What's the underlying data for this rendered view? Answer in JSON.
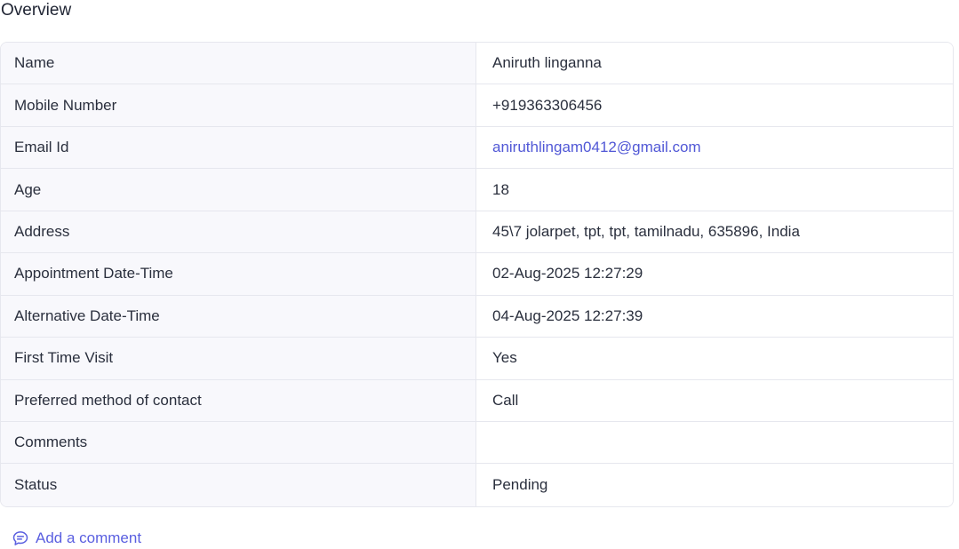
{
  "overview": {
    "title": "Overview",
    "rows": [
      {
        "label": "Name",
        "value": "Aniruth linganna"
      },
      {
        "label": "Mobile Number",
        "value": "+919363306456"
      },
      {
        "label": "Email Id",
        "value": "aniruthlingam0412@gmail.com"
      },
      {
        "label": "Age",
        "value": "18"
      },
      {
        "label": "Address",
        "value": "45\\7 jolarpet, tpt, tpt, tamilnadu, 635896, India"
      },
      {
        "label": "Appointment Date-Time",
        "value": "02-Aug-2025 12:27:29"
      },
      {
        "label": "Alternative Date-Time",
        "value": "04-Aug-2025 12:27:39"
      },
      {
        "label": "First Time Visit",
        "value": "Yes"
      },
      {
        "label": "Preferred method of contact",
        "value": "Call"
      },
      {
        "label": "Comments",
        "value": ""
      },
      {
        "label": "Status",
        "value": "Pending"
      }
    ]
  },
  "actions": {
    "add_comment_label": "Add a comment",
    "add_comment_icon": "comment-icon"
  },
  "colors": {
    "link": "#5158d6",
    "label_bg": "#f8f8fc",
    "border": "#e6e7ee",
    "text": "#2a2f3d"
  }
}
